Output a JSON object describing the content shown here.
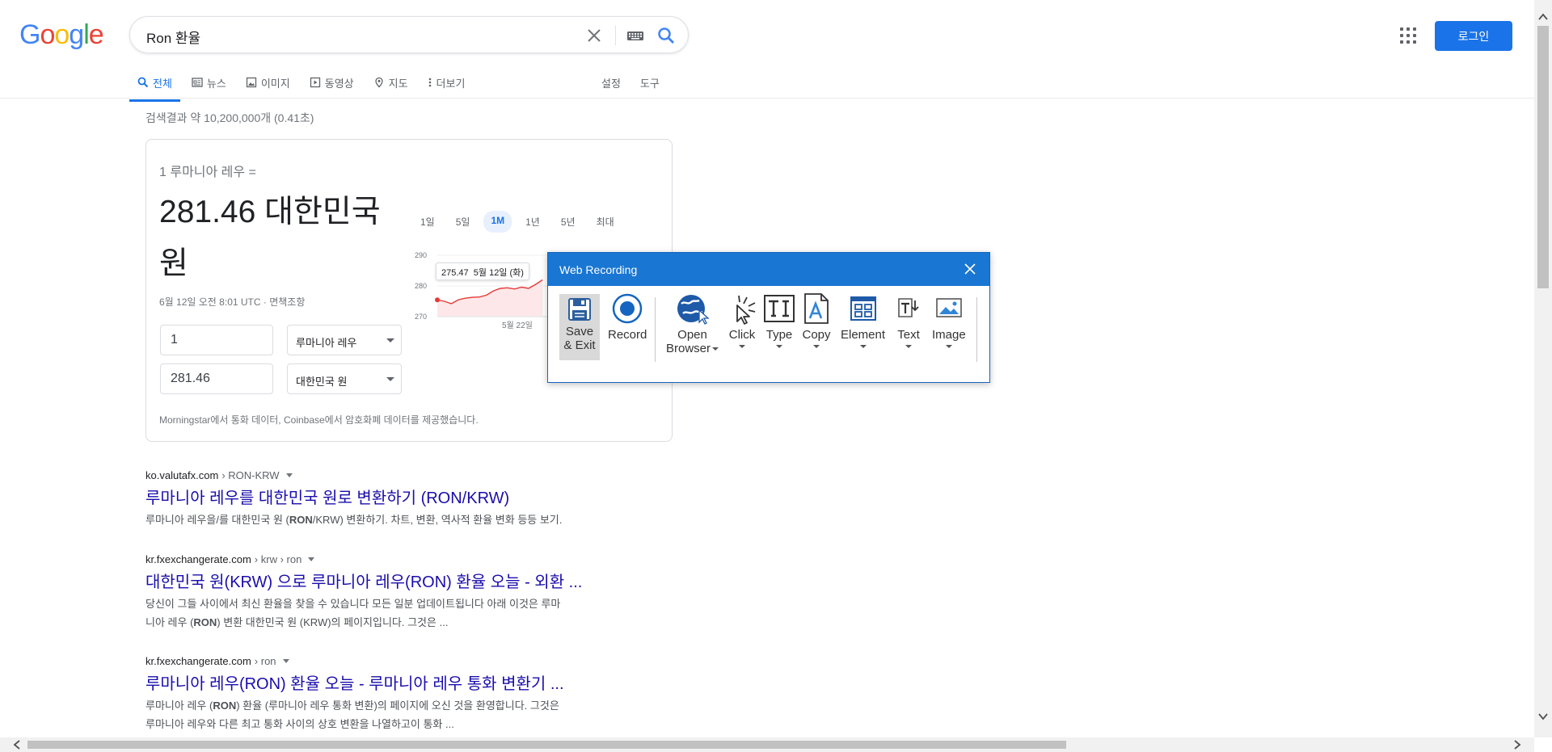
{
  "logo": "Google",
  "search": {
    "query": "Ron 환율"
  },
  "header": {
    "login": "로그인"
  },
  "tabs": [
    {
      "label": "전체",
      "icon": "search-icon",
      "active": true
    },
    {
      "label": "뉴스",
      "icon": "news-icon"
    },
    {
      "label": "이미지",
      "icon": "image-icon"
    },
    {
      "label": "동영상",
      "icon": "video-icon"
    },
    {
      "label": "지도",
      "icon": "map-pin-icon"
    },
    {
      "label": "더보기",
      "icon": "more-vert-icon"
    }
  ],
  "tools": {
    "settings": "설정",
    "tools": "도구"
  },
  "result_stats": "검색결과 약 10,200,000개 (0.41초)",
  "converter": {
    "from_label": "1 루마니아 레우 =",
    "value": "281.46 대한민국 원",
    "timestamp": "6월 12일 오전 8:01 UTC · 면책조항",
    "amount_from": "1",
    "currency_from": "루마니아 레우",
    "amount_to": "281.46",
    "currency_to": "대한민국 원",
    "footer": "Morningstar에서 통화 데이터, Coinbase에서 암호화폐 데이터를 제공했습니다.",
    "ranges": [
      "1일",
      "5일",
      "1M",
      "1년",
      "5년",
      "최대"
    ],
    "active_range": "1M",
    "tooltip_value": "275.47",
    "tooltip_date": "5월 12일 (화)",
    "y_ticks": [
      "290",
      "280",
      "270"
    ],
    "x_tick": "5월 22일"
  },
  "chart_data": {
    "type": "area",
    "ylim": [
      270,
      290
    ],
    "y_ticks": [
      290,
      280,
      270
    ],
    "x_ticks": [
      "5월 22일"
    ],
    "series": [
      {
        "values": [
          275.47,
          275.0,
          274.2,
          275.5,
          276.0,
          276.3,
          276.4,
          277.0,
          278.4,
          279.2,
          279.4,
          279.0,
          279.6,
          279.2,
          280.5,
          282.0
        ]
      }
    ],
    "line_color": "#e53935",
    "fill_color": "#fde7e9"
  },
  "results": [
    {
      "site": "ko.valutafx.com",
      "path": "› RON-KRW",
      "title": "루마니아 레우를 대한민국 원로 변환하기 (RON/KRW)",
      "snippet": [
        {
          "t": "루마니아 레우을/를 대한민국 원 ("
        },
        {
          "b": "RON"
        },
        {
          "t": "/KRW) 변환하기. 차트, 변환, 역사적 환율 변화 등등 보기."
        }
      ]
    },
    {
      "site": "kr.fxexchangerate.com",
      "path": "› krw › ron",
      "title": "대한민국 원(KRW) 으로 루마니아 레우(RON) 환율 오늘 - 외환 ...",
      "snippet_line1": "당신이 그들 사이에서 최신 환율을 찾을 수 있습니다 모든 일분 업데이트됩니다 아래 이것은 루마",
      "snippet_line2_a": "니아 레우 (",
      "snippet_line2_b": "RON",
      "snippet_line2_c": ") 변환 대한민국 원 (KRW)의 페이지입니다. 그것은 ..."
    },
    {
      "site": "kr.fxexchangerate.com",
      "path": "› ron",
      "title": "루마니아 레우(RON) 환율 오늘 - 루마니아 레우 통화 변환기 ...",
      "snippet_line1_a": "루마니아 레우 (",
      "snippet_line1_b": "RON",
      "snippet_line1_c": ") 환율 (루마니아 레우 통화 변환)의 페이지에 오신 것을 환영합니다. 그것은",
      "snippet_line2": "루마니아 레우와 다른 최고 통화 사이의 상호 변환을 나열하고이 통화 ..."
    }
  ],
  "recorder": {
    "title": "Web Recording",
    "save_line1": "Save",
    "save_line2": "& Exit",
    "record": "Record",
    "open_line1": "Open",
    "open_line2": "Browser",
    "click": "Click",
    "type": "Type",
    "copy": "Copy",
    "element": "Element",
    "text": "Text",
    "image": "Image"
  }
}
